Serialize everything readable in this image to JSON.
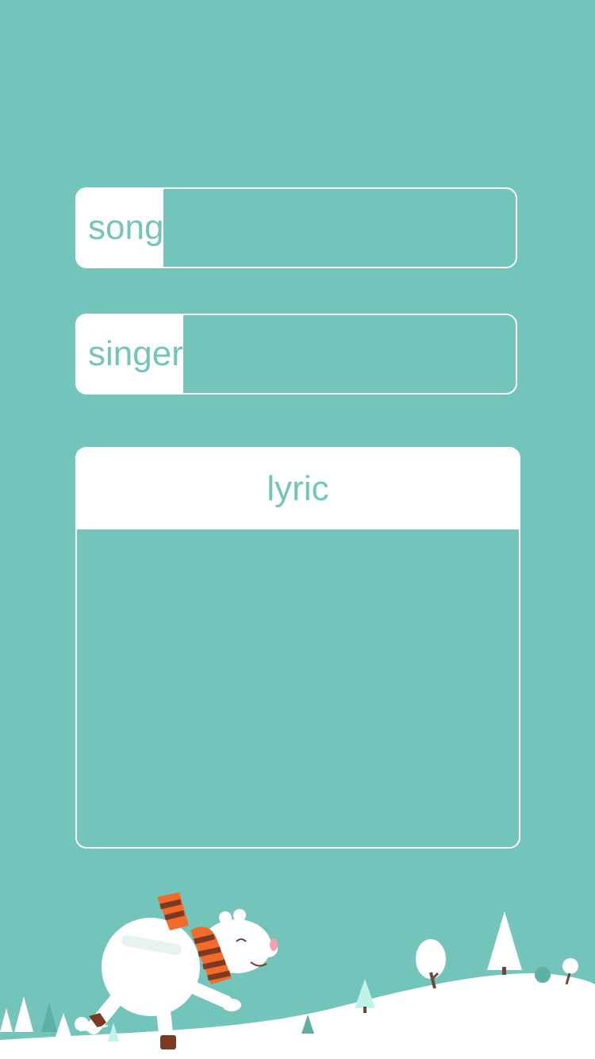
{
  "form": {
    "song": {
      "label": "song",
      "value": "",
      "placeholder": ""
    },
    "singer": {
      "label": "singer",
      "value": "",
      "placeholder": ""
    },
    "lyric": {
      "label": "lyric",
      "value": "",
      "placeholder": ""
    }
  },
  "colors": {
    "background": "#73c4bb",
    "panel": "#ffffff",
    "scarf_light": "#f26b2a",
    "scarf_dark": "#7a3b22"
  },
  "illustration": {
    "subject": "polar-bear-ice-skating",
    "icons": [
      "polar-bear-icon",
      "scarf-icon",
      "pine-tree-icon",
      "snow-tree-icon"
    ]
  }
}
